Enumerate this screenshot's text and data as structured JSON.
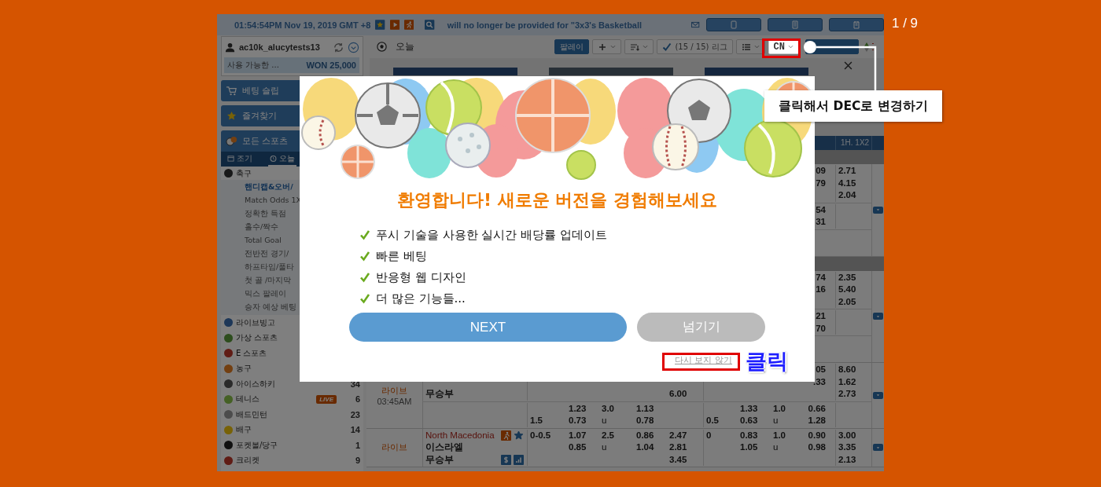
{
  "slide_counter": "1 / 9",
  "top_bar": {
    "datetime": "01:54:54PM Nov 19, 2019 GMT +8",
    "ticker": "will no longer be provided for \"3x3's Basketball"
  },
  "account": {
    "username": "ac10k_alucytests13",
    "balance_label": "사용 가능한 ...",
    "balance": "WON 25,000"
  },
  "sidebar": {
    "bet_slip": "베팅 슬립",
    "favorites": "즐겨찾기",
    "all_sports": "모든 스포츠",
    "tabs": [
      {
        "label": "조기",
        "selected": false
      },
      {
        "label": "오늘",
        "selected": true
      }
    ],
    "sports": [
      {
        "name": "축구",
        "children": [
          {
            "label": "핸디캡&오버/",
            "selected": true
          },
          {
            "label": "Match Odds 1X",
            "selected": false
          },
          {
            "label": "정확한 득점",
            "selected": false
          },
          {
            "label": "홀수/짝수",
            "selected": false
          },
          {
            "label": "Total Goal",
            "selected": false
          },
          {
            "label": "전반전 경기/",
            "selected": false
          },
          {
            "label": "하프타임/풀타",
            "selected": false
          },
          {
            "label": "첫 골 /마지막",
            "selected": false
          },
          {
            "label": "믹스 팔레이",
            "selected": false
          },
          {
            "label": "승자 예상 베팅",
            "selected": false
          }
        ]
      },
      {
        "name": "라이브빙고"
      },
      {
        "name": "가상 스포츠"
      },
      {
        "name": "E 스포츠"
      },
      {
        "name": "농구"
      },
      {
        "name": "아이스하키",
        "count": "34"
      },
      {
        "name": "테니스",
        "badge": "LIVE",
        "count": "6"
      },
      {
        "name": "배드민턴",
        "count": "23"
      },
      {
        "name": "배구",
        "count": "14"
      },
      {
        "name": "포켓볼/당구",
        "count": "1"
      },
      {
        "name": "크리켓",
        "count": "9"
      }
    ]
  },
  "main": {
    "title": "오늘",
    "toolbar": [
      {
        "kind": "primary",
        "label": "팔레이"
      },
      {
        "kind": "plus-menu"
      },
      {
        "kind": "sort-menu"
      },
      {
        "kind": "league-filter",
        "label": "(15 / 15) 리그"
      },
      {
        "kind": "list-menu"
      },
      {
        "kind": "odds-format",
        "label": "CN"
      },
      {
        "kind": "primary"
      },
      {
        "kind": "arrows"
      }
    ]
  },
  "table": {
    "header": {
      "column_11": "1H. 1X2"
    },
    "blocks": [
      {
        "kind": "league"
      },
      {
        "kind": "match",
        "sections": [
          {
            "kind": "lines",
            "lines": [
              {
                "column_10": "09",
                "column_11": "2.71"
              },
              {
                "column_10": "79",
                "column_11": "4.15"
              },
              {
                "column_11": "2.04"
              }
            ]
          },
          {
            "kind": "lines",
            "lines": [
              {
                "column_10": "54"
              },
              {
                "column_10": "31"
              }
            ]
          },
          {
            "kind": "blank"
          }
        ]
      },
      {
        "kind": "league"
      },
      {
        "kind": "match",
        "sections": [
          {
            "kind": "lines",
            "lines": [
              {
                "column_10": "74",
                "column_11": "2.35"
              },
              {
                "column_10": "16",
                "column_11": "5.40"
              },
              {
                "column_11": "2.05"
              }
            ]
          },
          {
            "kind": "lines",
            "lines": [
              {
                "column_10": "21"
              },
              {
                "column_10": "70"
              }
            ]
          },
          {
            "kind": "blank"
          }
        ]
      },
      {
        "kind": "match",
        "time": [
          "라이브",
          "03:45AM"
        ],
        "sections": [
          {
            "kind": "lines",
            "teams": [
              {
                "name": "무승부",
                "kind": "draw"
              }
            ],
            "lines": [
              {
                "column_10": "05",
                "column_11": "8.60"
              },
              {
                "column_10": ".33",
                "column_11": "1.62"
              },
              {
                "column_6": "6.00",
                "column_11": "2.73"
              }
            ]
          },
          {
            "kind": "lines",
            "lines": [
              {
                "column_3": "1.23",
                "column_4": "3.0",
                "column_5": "1.13",
                "column_8": "1.33",
                "column_9": "1.0",
                "column_10": "0.66"
              },
              {
                "column_2": "1.5",
                "column_3": "0.73",
                "column_4": "u",
                "column_5": "0.78",
                "column_7": "0.5",
                "column_8": "0.63",
                "column_9": "u",
                "column_10": "1.28"
              }
            ]
          }
        ]
      },
      {
        "kind": "match",
        "time": [
          "라이브"
        ],
        "favorite": true,
        "sections": [
          {
            "kind": "lines",
            "teams": [
              {
                "name": "North Macedonia",
                "kind": "home"
              },
              {
                "name": "이스라엘",
                "kind": "away"
              },
              {
                "name": "무승부",
                "kind": "draw"
              }
            ],
            "lines": [
              {
                "column_2": "0-0.5",
                "column_3": "1.07",
                "column_4": "2.5",
                "column_5": "0.86",
                "column_6": "2.47",
                "column_7": "0",
                "column_8": "0.83",
                "column_9": "1.0",
                "column_10": "0.90",
                "column_11": "3.00"
              },
              {
                "column_3": "0.85",
                "column_4": "u",
                "column_5": "1.04",
                "column_6": "2.81",
                "column_8": "1.05",
                "column_9": "u",
                "column_10": "0.98",
                "column_11": "3.35"
              },
              {
                "column_6": "3.45",
                "column_11": "2.13"
              }
            ]
          }
        ]
      }
    ]
  },
  "modal": {
    "title": "환영합니다! 새로운 버전을 경험해보세요",
    "features": [
      "푸시 기술을 사용한 실시간 배당률 업데이트",
      "빠른 베팅",
      "반응형 웹 디자인",
      "더 많은 기능들..."
    ],
    "next_button": "NEXT",
    "skip_button": "넘기기",
    "dont_show_link": "다시 보지 않기"
  },
  "annotations": [
    {
      "kind": "callout",
      "text": "클릭해서 DEC로 변경하기"
    },
    {
      "kind": "click-label",
      "text": "클릭"
    }
  ]
}
